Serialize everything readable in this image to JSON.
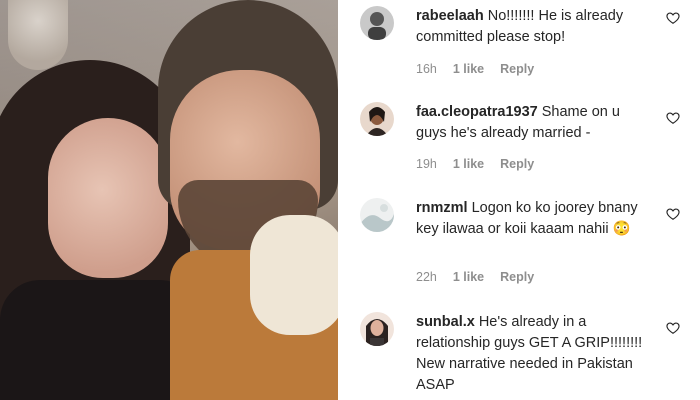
{
  "comments": [
    {
      "username": "rabeelaah",
      "text": "No!!!!!!! He is already committed please stop!",
      "time": "16h",
      "likes": "1 like",
      "reply": "Reply"
    },
    {
      "username": "faa.cleopatra1937",
      "text": "Shame on u guys he's already married -",
      "time": "19h",
      "likes": "1 like",
      "reply": "Reply"
    },
    {
      "username": "rnmzml",
      "text": "Logon ko ko joorey bnany key ilawaa or koii kaaam nahii",
      "emoji": "😳",
      "time": "22h",
      "likes": "1 like",
      "reply": "Reply"
    },
    {
      "username": "sunbal.x",
      "text": "He's already in a relationship guys GET A GRIP!!!!!!!! New narrative needed in Pakistan ASAP"
    }
  ],
  "icons": {
    "like": "heart-outline-icon"
  },
  "colors": {
    "text": "#262626",
    "meta": "#8e8e8e"
  }
}
